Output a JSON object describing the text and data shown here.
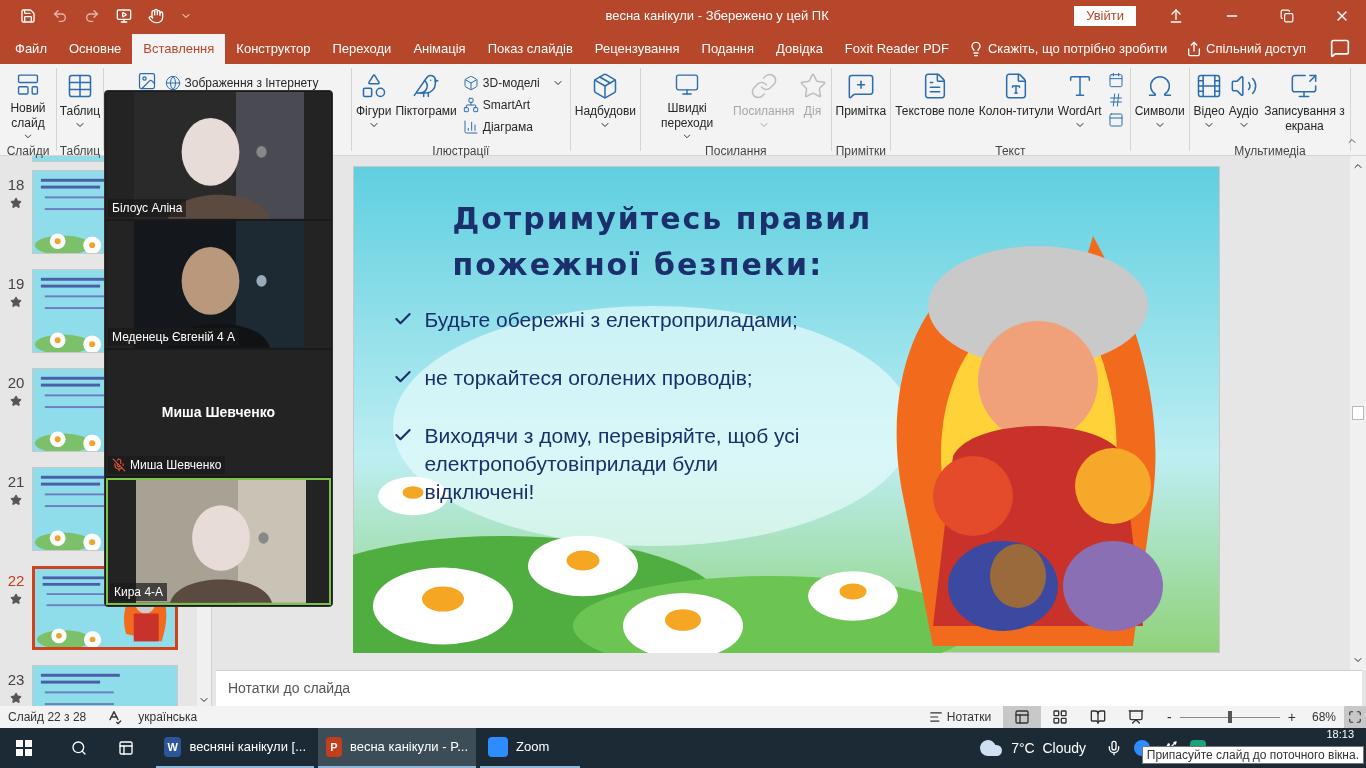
{
  "title_bar": {
    "title": "весна канікули  -  Збережено у цей ПК",
    "sign_in": "Увійти"
  },
  "menu_tabs": [
    {
      "label": "Файл",
      "selected": false
    },
    {
      "label": "Основне",
      "selected": false
    },
    {
      "label": "Вставлення",
      "selected": true
    },
    {
      "label": "Конструктор",
      "selected": false
    },
    {
      "label": "Переходи",
      "selected": false
    },
    {
      "label": "Анімація",
      "selected": false
    },
    {
      "label": "Показ слайдів",
      "selected": false
    },
    {
      "label": "Рецензування",
      "selected": false
    },
    {
      "label": "Подання",
      "selected": false
    },
    {
      "label": "Довідка",
      "selected": false
    },
    {
      "label": "Foxit Reader PDF",
      "selected": false
    }
  ],
  "tell_me": "Скажіть, що потрібно зробити",
  "share": "Спільний доступ",
  "ribbon_groups": [
    {
      "label": "Слайди",
      "commands": [
        {
          "kind": "large",
          "label": "Новий слайд",
          "dropdown": true,
          "disabled": false
        }
      ]
    },
    {
      "label": "Таблиц",
      "commands": [
        {
          "kind": "large",
          "label": "Таблиц",
          "dropdown": true,
          "disabled": false
        }
      ]
    },
    {
      "commands": [
        {
          "kind": "icon"
        },
        {
          "kind": "small",
          "label": "Зображення з Інтернету",
          "dropdown": false,
          "disabled": false
        }
      ]
    },
    {
      "label": "Ілюстрації",
      "commands": [
        {
          "kind": "large",
          "label": "Фігури",
          "dropdown": true,
          "disabled": false
        },
        {
          "kind": "large",
          "label": "Піктограми",
          "dropdown": false,
          "disabled": false
        },
        {
          "kind": "small",
          "label": "3D-моделі",
          "dropdown": true,
          "disabled": false
        },
        {
          "kind": "small",
          "label": "SmartArt",
          "dropdown": false,
          "disabled": false
        },
        {
          "kind": "small",
          "label": "Діаграма",
          "dropdown": false,
          "disabled": false
        }
      ]
    },
    {
      "commands": [
        {
          "kind": "large",
          "label": "Надбудови",
          "dropdown": true,
          "disabled": false
        }
      ]
    },
    {
      "label": "Посилання",
      "commands": [
        {
          "kind": "large",
          "label": "Швидкі переходи",
          "dropdown": true,
          "disabled": false
        },
        {
          "kind": "large",
          "label": "Посилання",
          "dropdown": true,
          "disabled": true
        },
        {
          "kind": "large",
          "label": "Дія",
          "dropdown": false,
          "disabled": true
        }
      ]
    },
    {
      "label": "Примітки",
      "commands": [
        {
          "kind": "large",
          "label": "Примітка",
          "dropdown": false,
          "disabled": false
        }
      ]
    },
    {
      "label": "Текст",
      "commands": [
        {
          "kind": "large",
          "label": "Текстове поле",
          "dropdown": false,
          "disabled": false
        },
        {
          "kind": "large",
          "label": "Колон-титули",
          "dropdown": false,
          "disabled": false
        },
        {
          "kind": "large",
          "label": "WordArt",
          "dropdown": true,
          "disabled": false
        },
        {
          "kind": "iconstack",
          "disabled": false
        }
      ]
    },
    {
      "commands": [
        {
          "kind": "large",
          "label": "Символи",
          "dropdown": true,
          "disabled": false
        }
      ]
    },
    {
      "label": "Мультимедіа",
      "commands": [
        {
          "kind": "large",
          "label": "Відео",
          "dropdown": true,
          "disabled": false
        },
        {
          "kind": "large",
          "label": "Аудіо",
          "dropdown": true,
          "disabled": false
        },
        {
          "kind": "large",
          "label": "Записування з екрана",
          "dropdown": false,
          "disabled": false
        }
      ]
    }
  ],
  "thumbnails": [
    {
      "number": "18",
      "selected": false,
      "kind": "text"
    },
    {
      "number": "19",
      "selected": false,
      "kind": "text"
    },
    {
      "number": "20",
      "selected": false,
      "kind": "text"
    },
    {
      "number": "21",
      "selected": false,
      "kind": "text"
    },
    {
      "number": "22",
      "selected": true,
      "kind": "fireman"
    },
    {
      "number": "23",
      "selected": false,
      "kind": "text"
    }
  ],
  "slide": {
    "title": [
      "Дотримуйтесь правил",
      "пожежної безпеки:"
    ],
    "bullets": [
      "Будьте обережні з електроприладами;",
      " не торкайтеся оголених проводів;",
      "Виходячи з дому, перевіряйте, щоб усі електропобутовіприлади були відключені!"
    ]
  },
  "notes_placeholder": "Нотатки до слайда",
  "status_bar": {
    "slide_counter": "Слайд 22 з 28",
    "language": "українська",
    "notes": "Нотатки",
    "views": [
      {
        "selected": true
      },
      {
        "selected": false
      },
      {
        "selected": false
      },
      {
        "selected": false
      }
    ],
    "zoom_minus": "-",
    "zoom_plus": "+",
    "level": 0.5,
    "zoom": "68%"
  },
  "taskbar": {
    "apps": [
      {
        "label": "весняні канікули [...",
        "kind": "word",
        "icon_letter": "W",
        "selected": false
      },
      {
        "label": "весна канікули - P...",
        "kind": "powerpoint",
        "icon_letter": "P",
        "selected": true
      },
      {
        "label": "Zoom",
        "kind": "zoom",
        "selected": false
      }
    ],
    "weather": "7°C  Cloudy",
    "time": "18:13"
  },
  "tooltip": "Припасуйте слайд до поточного вікна.",
  "video_call": {
    "tiles": [
      {
        "name": "Білоус Аліна",
        "kind": "video",
        "muted": false,
        "speaking": false
      },
      {
        "name": "Меденець Євгеній 4 А",
        "kind": "video",
        "muted": false,
        "speaking": false
      },
      {
        "name": "Миша Шевченко",
        "kind": "avatar",
        "display_name": "Миша Шевченко",
        "muted": true,
        "speaking": false
      },
      {
        "name": "Кира 4-А",
        "kind": "video",
        "muted": false,
        "speaking": true
      }
    ]
  }
}
